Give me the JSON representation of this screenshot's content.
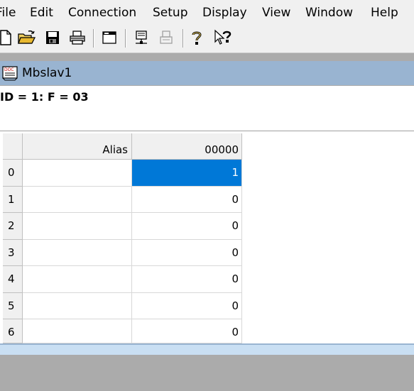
{
  "menu": [
    "File",
    "Edit",
    "Connection",
    "Setup",
    "Display",
    "View",
    "Window",
    "Help"
  ],
  "window": {
    "title": "Mbslav1"
  },
  "status_line": "ID = 1: F = 03",
  "grid": {
    "columns": [
      "Alias",
      "00000"
    ],
    "rows": [
      {
        "index": "0",
        "alias": "",
        "value": "1",
        "selected": true
      },
      {
        "index": "1",
        "alias": "",
        "value": "0"
      },
      {
        "index": "2",
        "alias": "",
        "value": "0"
      },
      {
        "index": "3",
        "alias": "",
        "value": "0"
      },
      {
        "index": "4",
        "alias": "",
        "value": "0"
      },
      {
        "index": "5",
        "alias": "",
        "value": "0"
      },
      {
        "index": "6",
        "alias": "",
        "value": "0"
      }
    ]
  },
  "toolbar_icons": [
    "new-file-icon",
    "open-folder-icon",
    "save-icon",
    "print-icon",
    "window-icon",
    "connect-icon",
    "disconnect-icon",
    "help-icon",
    "context-help-icon"
  ],
  "colors": {
    "selection": "#0078d7",
    "mdi_title": "#99b4d1",
    "workspace": "#ababab"
  }
}
